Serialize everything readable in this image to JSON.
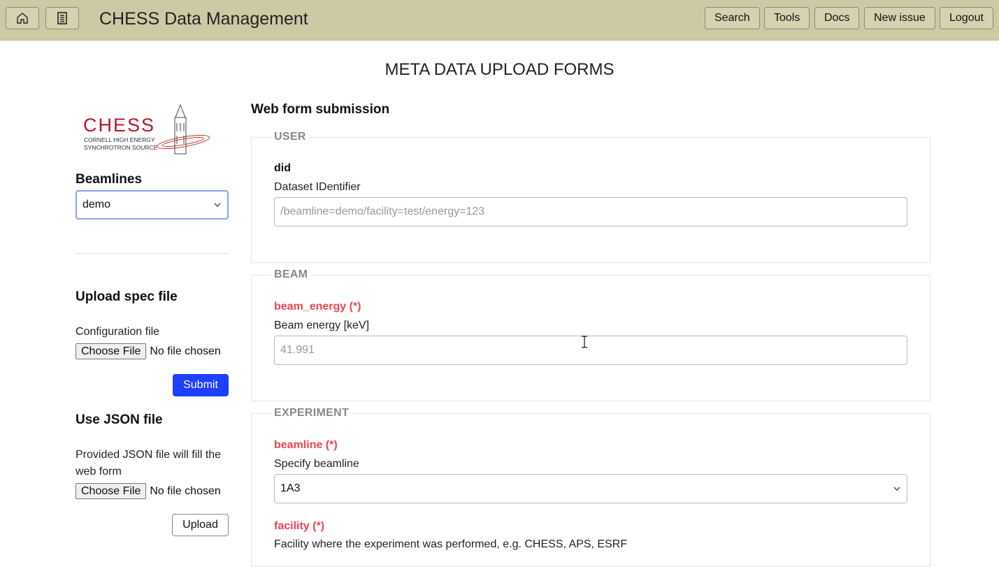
{
  "header": {
    "title": "CHESS Data Management",
    "home_icon": "home-icon",
    "doc_icon": "document-icon",
    "nav": [
      "Search",
      "Tools",
      "Docs",
      "New issue",
      "Logout"
    ]
  },
  "page": {
    "heading": "META DATA UPLOAD FORMS"
  },
  "sidebar": {
    "logo": {
      "name": "CHESS",
      "line1": "CORNELL HIGH ENERGY",
      "line2": "SYNCHROTRON SOURCE"
    },
    "beamlines_label": "Beamlines",
    "beamline_selected": "demo",
    "upload_spec": {
      "heading": "Upload spec file",
      "config_label": "Configuration file",
      "choose_label": "Choose File",
      "file_status": "No file chosen",
      "submit_label": "Submit"
    },
    "json": {
      "heading": "Use JSON file",
      "description": "Provided JSON file will fill the web form",
      "choose_label": "Choose File",
      "file_status": "No file chosen",
      "upload_label": "Upload"
    }
  },
  "main": {
    "heading": "Web form submission",
    "sections": {
      "user": {
        "legend": "USER",
        "field_name": "did",
        "field_desc": "Dataset IDentifier",
        "placeholder": "/beamline=demo/facility=test/energy=123"
      },
      "beam": {
        "legend": "BEAM",
        "field_name": "beam_energy (*)",
        "field_desc": "Beam energy [keV]",
        "placeholder": "41.991"
      },
      "experiment": {
        "legend": "EXPERIMENT",
        "beamline_name": "beamline (*)",
        "beamline_desc": "Specify beamline",
        "beamline_value": "1A3",
        "facility_name": "facility (*)",
        "facility_desc": "Facility where the experiment was performed, e.g. CHESS, APS, ESRF"
      }
    }
  },
  "colors": {
    "header_bg": "#cdc9a5",
    "required": "#ef4451",
    "primary_button": "#1d3fff",
    "logo_red": "#b0182b"
  }
}
